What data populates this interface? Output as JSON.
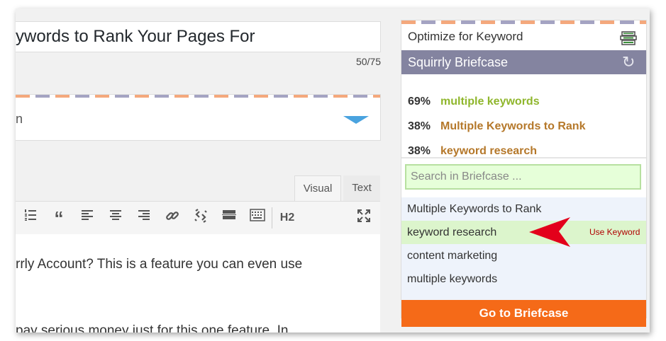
{
  "editor": {
    "title_text": "ywords to Rank Your Pages For",
    "char_count": "50/75",
    "collapsed_box_text": "n",
    "tabs": {
      "visual": "Visual",
      "text": "Text"
    },
    "toolbar": {
      "quote_glyph": "“",
      "heading": "H2"
    },
    "content_lines": [
      "rrly Account? This is a feature you can even use",
      "pay serious money just for this one feature. In"
    ]
  },
  "panel": {
    "optimize_label": "Optimize for Keyword",
    "briefcase_title": "Squirrly Briefcase",
    "keywords": [
      {
        "pct": "69%",
        "name": "multiple keywords",
        "color": "#8fb62c"
      },
      {
        "pct": "38%",
        "name": "Multiple Keywords to Rank",
        "color": "#b5782a"
      },
      {
        "pct": "38%",
        "name": "keyword research",
        "color": "#b5782a"
      }
    ],
    "search_placeholder": "Search in Briefcase ...",
    "briefcase_items": [
      {
        "label": "Multiple Keywords to Rank"
      },
      {
        "label": "keyword research",
        "action": "Use Keyword"
      },
      {
        "label": "content marketing"
      },
      {
        "label": "multiple keywords"
      }
    ],
    "goto_button": "Go to Briefcase"
  },
  "colors": {
    "briefcase_bar": "#8484a0",
    "goto_button": "#f56a18",
    "highlight_row": "#dcf5cc",
    "search_bg": "#e6ffd9",
    "arrow": "#e3001b"
  }
}
